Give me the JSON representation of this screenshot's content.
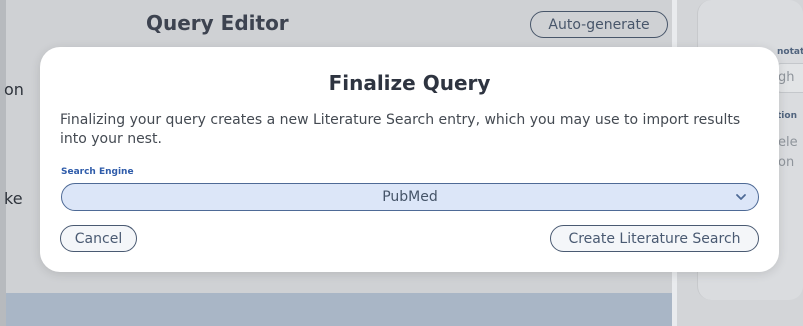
{
  "background": {
    "title": "Query Editor",
    "auto_generate": "Auto-generate",
    "left_text_1": "on",
    "left_text_2": "ke",
    "right_label_1": "notatio",
    "right_field_text": "gh",
    "right_label_2": "tion",
    "right_text_1": "ele",
    "right_text_2": "on"
  },
  "modal": {
    "title": "Finalize Query",
    "description": "Finalizing your query creates a new Literature Search entry, which you may use to import results into your nest.",
    "field_label": "Search Engine",
    "search_engine_value": "PubMed",
    "cancel_label": "Cancel",
    "create_label": "Create Literature Search"
  },
  "colors": {
    "accent": "#4a5a72",
    "select_bg": "#dce6f8",
    "label_blue": "#2f5caa"
  },
  "icons": {
    "select_chevron": "chevron-down-icon"
  }
}
